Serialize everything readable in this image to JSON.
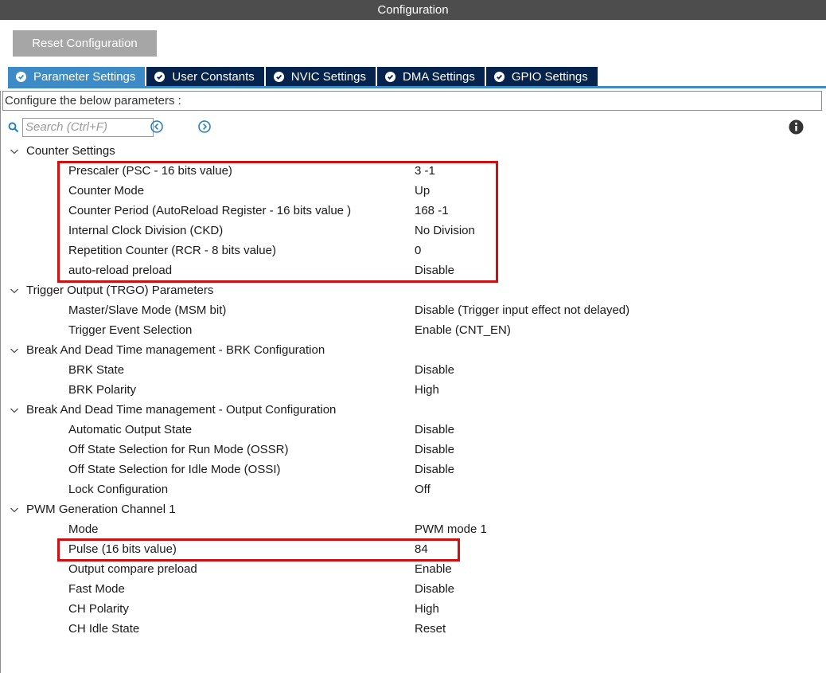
{
  "window": {
    "title": "Configuration"
  },
  "toolbar": {
    "reset_label": "Reset Configuration"
  },
  "tabs": [
    {
      "label": "Parameter Settings",
      "active": true
    },
    {
      "label": "User Constants",
      "active": false
    },
    {
      "label": "NVIC Settings",
      "active": false
    },
    {
      "label": "DMA Settings",
      "active": false
    },
    {
      "label": "GPIO Settings",
      "active": false
    }
  ],
  "description": "Configure the below parameters :",
  "search": {
    "placeholder": "Search (Ctrl+F)",
    "value": ""
  },
  "icons": {
    "search": "search-icon",
    "prev": "chevron-left-circle-icon",
    "next": "chevron-right-circle-icon",
    "info": "info-icon",
    "expand": "chevron-down-icon",
    "tab_check": "check-circle-icon"
  },
  "colors": {
    "titlebar": "#4d4d4d",
    "tab_active": "#3c8bc7",
    "tab_inactive": "#05234d",
    "highlight": "#d01010"
  },
  "groups": [
    {
      "label": "Counter Settings",
      "params": [
        {
          "name": "Prescaler (PSC - 16 bits value)",
          "value": "3 -1"
        },
        {
          "name": "Counter Mode",
          "value": "Up"
        },
        {
          "name": "Counter Period (AutoReload Register - 16 bits value )",
          "value": "168 -1"
        },
        {
          "name": "Internal Clock Division (CKD)",
          "value": "No Division"
        },
        {
          "name": "Repetition Counter (RCR - 8 bits value)",
          "value": "0"
        },
        {
          "name": "auto-reload preload",
          "value": "Disable"
        }
      ]
    },
    {
      "label": "Trigger Output (TRGO) Parameters",
      "params": [
        {
          "name": "Master/Slave Mode (MSM bit)",
          "value": "Disable (Trigger input effect not delayed)"
        },
        {
          "name": "Trigger Event Selection",
          "value": "Enable (CNT_EN)"
        }
      ]
    },
    {
      "label": "Break And Dead Time management - BRK Configuration",
      "params": [
        {
          "name": "BRK State",
          "value": "Disable"
        },
        {
          "name": "BRK Polarity",
          "value": "High"
        }
      ]
    },
    {
      "label": "Break And Dead Time management - Output Configuration",
      "params": [
        {
          "name": "Automatic Output State",
          "value": "Disable"
        },
        {
          "name": "Off State Selection for Run Mode (OSSR)",
          "value": "Disable"
        },
        {
          "name": "Off State Selection for Idle Mode (OSSI)",
          "value": "Disable"
        },
        {
          "name": "Lock Configuration",
          "value": "Off"
        }
      ]
    },
    {
      "label": "PWM Generation Channel 1",
      "params": [
        {
          "name": "Mode",
          "value": "PWM mode 1"
        },
        {
          "name": "Pulse (16 bits value)",
          "value": "84"
        },
        {
          "name": "Output compare preload",
          "value": "Enable"
        },
        {
          "name": "Fast Mode",
          "value": "Disable"
        },
        {
          "name": "CH Polarity",
          "value": "High"
        },
        {
          "name": "CH Idle State",
          "value": "Reset"
        }
      ]
    }
  ]
}
